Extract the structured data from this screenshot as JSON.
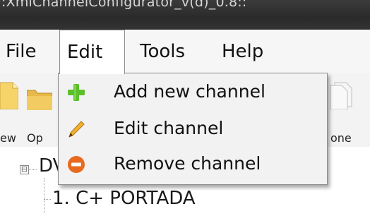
{
  "window": {
    "title": ":XmiChannelConfigurator_v(d)_0.8::"
  },
  "menubar": {
    "items": [
      {
        "label": "File"
      },
      {
        "label": "Edit"
      },
      {
        "label": "Tools"
      },
      {
        "label": "Help"
      }
    ]
  },
  "toolbar": {
    "new_label": "ew",
    "open_label": "Op",
    "clone_label": "one"
  },
  "edit_menu": {
    "items": [
      {
        "label": "Add new channel",
        "icon": "plus-icon",
        "color": "#5cbf2a"
      },
      {
        "label": "Edit channel",
        "icon": "pencil-icon",
        "color": "#e0a020"
      },
      {
        "label": "Remove channel",
        "icon": "remove-icon",
        "color": "#e86a1e"
      }
    ]
  },
  "tree": {
    "root_label": "DV",
    "expander": "⊟",
    "items": [
      {
        "label": "1. C+ PORTADA"
      }
    ]
  }
}
